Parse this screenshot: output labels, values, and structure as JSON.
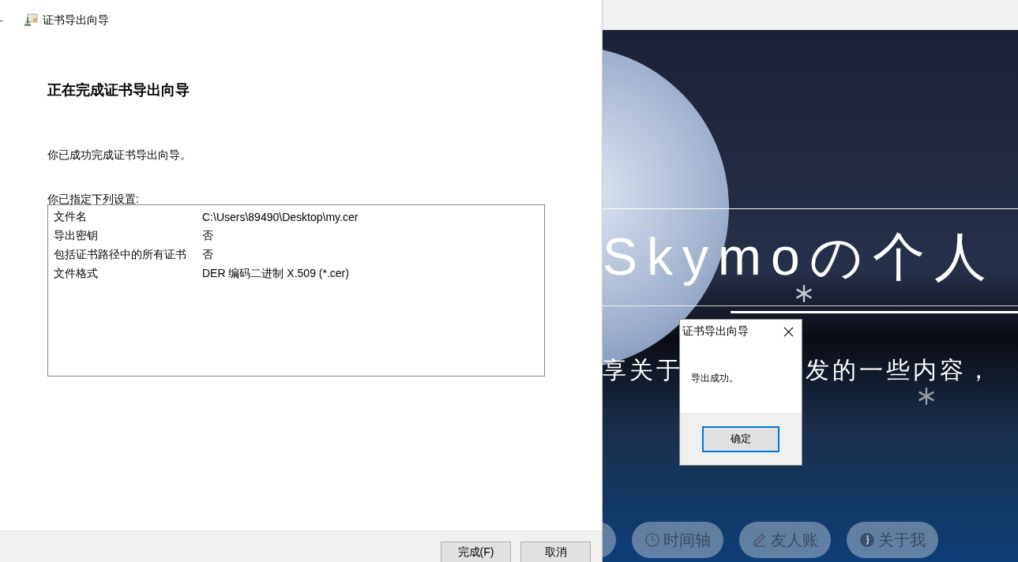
{
  "wizard": {
    "title": "证书导出向导",
    "heading": "正在完成证书导出向导",
    "message": "你已成功完成证书导出向导。",
    "settings_label": "你已指定下列设置:",
    "settings": [
      {
        "name": "文件名",
        "value": "C:\\Users\\89490\\Desktop\\my.cer"
      },
      {
        "name": "导出密钥",
        "value": "否"
      },
      {
        "name": "包括证书路径中的所有证书",
        "value": "否"
      },
      {
        "name": "文件格式",
        "value": "DER 编码二进制 X.509 (*.cer)"
      }
    ],
    "buttons": [
      {
        "label": "完成(F)"
      },
      {
        "label": "取消"
      }
    ]
  },
  "blog": {
    "title": "Skymoの个人",
    "subtitle_parts": [
      "享关于",
      "发的一些内容，"
    ],
    "nav": [
      {
        "label": "时间轴"
      },
      {
        "label": "友人账"
      },
      {
        "label": "关于我"
      }
    ]
  },
  "dialog": {
    "title": "证书导出向导",
    "message": "导出成功。",
    "button": "确定"
  }
}
